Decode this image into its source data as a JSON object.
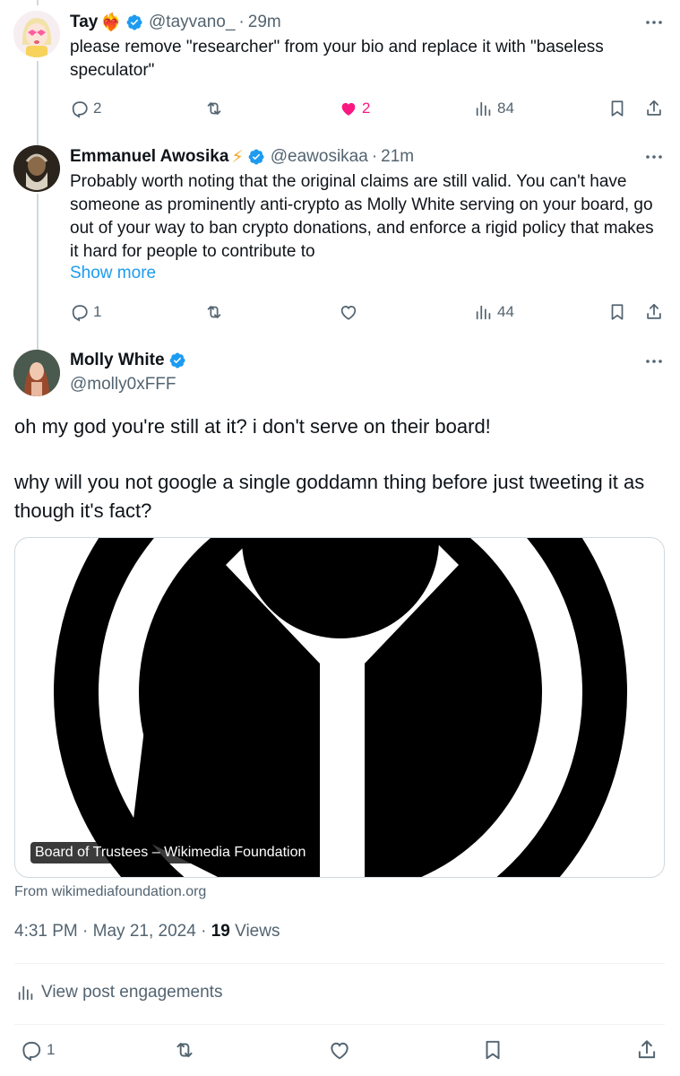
{
  "replies": [
    {
      "name": "Tay",
      "emoji": "❤️‍🔥",
      "handle": "@tayvano_",
      "time": "29m",
      "text": "please remove \"researcher\" from your bio and replace it with \"baseless speculator\"",
      "show_more": "",
      "reply_count": "2",
      "repost_count": "",
      "like_count": "2",
      "liked": true,
      "views": "84"
    },
    {
      "name": "Emmanuel Awosika",
      "emoji": "⚡",
      "handle": "@eawosikaa",
      "time": "21m",
      "text": "Probably worth noting that the original claims are still valid. You can't have someone as prominently anti-crypto as Molly White serving on your board, go out of your way to ban crypto donations, and enforce a rigid policy that makes it hard for people to contribute to",
      "show_more": "Show more",
      "reply_count": "1",
      "repost_count": "",
      "like_count": "",
      "liked": false,
      "views": "44"
    }
  ],
  "main_post": {
    "name": "Molly White",
    "handle": "@molly0xFFF",
    "text_line1": "oh my god you're still at it? i don't serve on their board!",
    "text_line2": "why will you not google a single goddamn thing before just tweeting it as though it's fact?",
    "card_title": "Board of Trustees – Wikimedia Foundation",
    "card_source": "From wikimediafoundation.org",
    "time": "4:31 PM",
    "date": "May 21, 2024",
    "views_count": "19",
    "views_label": "Views",
    "engagements_label": "View post engagements",
    "reply_count": "1"
  },
  "colors": {
    "text": "#0f1419",
    "secondary": "#536471",
    "link": "#1d9bf0",
    "verified": "#1d9bf0",
    "like_active": "#f91880",
    "border": "#cfd9de"
  },
  "icons": [
    "verified-badge-icon",
    "more-icon",
    "reply-icon",
    "repost-icon",
    "like-icon",
    "views-icon",
    "bookmark-icon",
    "share-icon"
  ]
}
